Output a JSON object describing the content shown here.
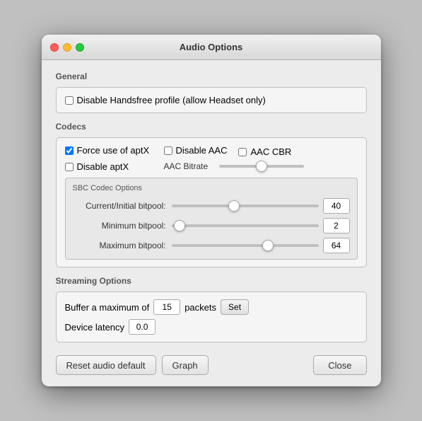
{
  "window": {
    "title": "Audio Options"
  },
  "general": {
    "label": "General",
    "disable_handsfree_label": "Disable Handsfree profile (allow Headset only)",
    "disable_handsfree_checked": false
  },
  "codecs": {
    "label": "Codecs",
    "force_aptx_label": "Force use of aptX",
    "force_aptx_checked": true,
    "disable_aptx_label": "Disable aptX",
    "disable_aptx_checked": false,
    "disable_aac_label": "Disable AAC",
    "disable_aac_checked": false,
    "aac_cbr_label": "AAC CBR",
    "aac_cbr_checked": false,
    "aac_bitrate_label": "AAC Bitrate",
    "aac_bitrate_value": 50,
    "sbc_title": "SBC Codec Options",
    "current_bitpool_label": "Current/Initial bitpool:",
    "current_bitpool_value": "40",
    "current_bitpool_slider": 40,
    "minimum_bitpool_label": "Minimum bitpool:",
    "minimum_bitpool_value": "2",
    "minimum_bitpool_slider": 2,
    "maximum_bitpool_label": "Maximum bitpool:",
    "maximum_bitpool_value": "64",
    "maximum_bitpool_slider": 64
  },
  "streaming": {
    "label": "Streaming Options",
    "buffer_prefix": "Buffer a maximum of",
    "buffer_value": "15",
    "buffer_suffix": "packets",
    "set_label": "Set",
    "latency_label": "Device latency",
    "latency_value": "0.0"
  },
  "footer": {
    "reset_label": "Reset audio default",
    "graph_label": "Graph",
    "close_label": "Close"
  }
}
